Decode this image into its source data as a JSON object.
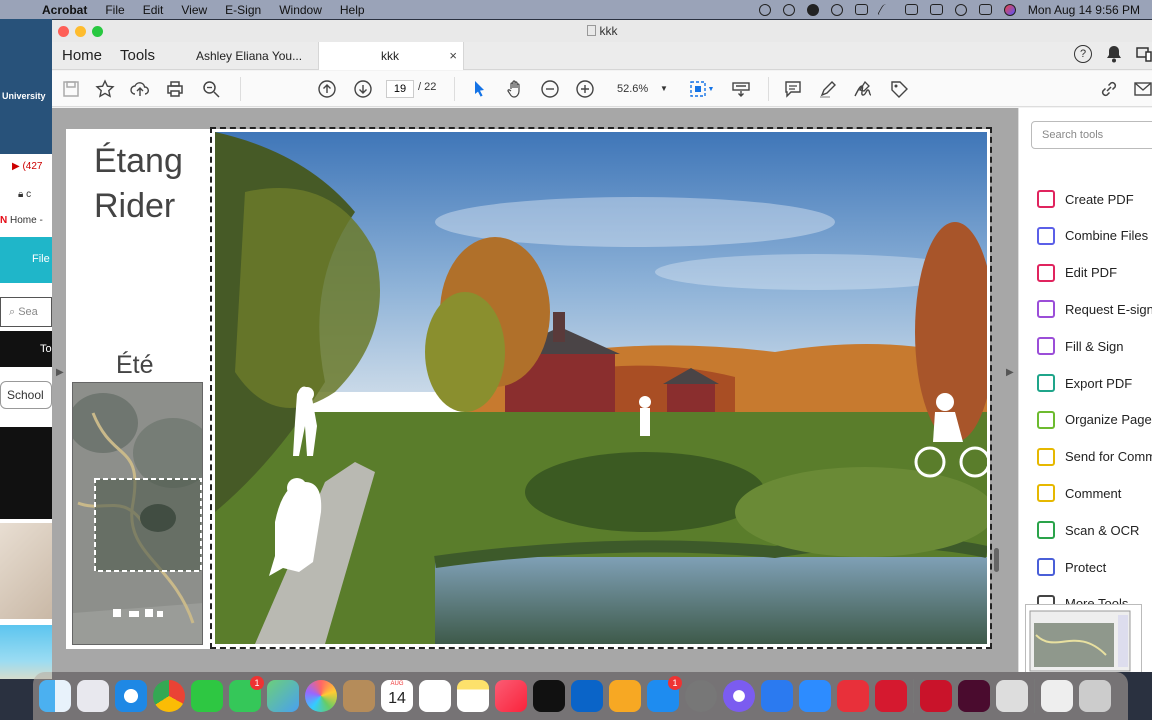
{
  "menubar": {
    "app_name": "Acrobat",
    "items": [
      "File",
      "Edit",
      "View",
      "E-Sign",
      "Window",
      "Help"
    ],
    "datetime": "Mon Aug 14  9:56 PM"
  },
  "background_window": {
    "blue_label": "University",
    "youtube_count": "(427",
    "address_text": "c",
    "netflix_label": "Home -",
    "file_button": "File",
    "search_placeholder": "Sea",
    "dark_tab": "To",
    "school_chip": "School"
  },
  "window": {
    "title": "kkk",
    "tabs": {
      "home": "Home",
      "tools": "Tools",
      "doc1": "Ashley Eliana You...",
      "doc2": "kkk",
      "close": "×"
    },
    "help_icon": "?"
  },
  "toolbar": {
    "current_page": "19",
    "total_pages": "/ 22",
    "zoom": "52.6%"
  },
  "document": {
    "title_line1": "Étang",
    "title_line2": "Rider",
    "season": "Été"
  },
  "tools_panel": {
    "search_placeholder": "Search tools",
    "items": [
      {
        "label": "Create PDF",
        "color": "#e0245e"
      },
      {
        "label": "Combine Files",
        "color": "#5b5fe8"
      },
      {
        "label": "Edit PDF",
        "color": "#e0245e"
      },
      {
        "label": "Request E-signa",
        "color": "#9b4ed8"
      },
      {
        "label": "Fill & Sign",
        "color": "#9b4ed8"
      },
      {
        "label": "Export PDF",
        "color": "#1fa58a"
      },
      {
        "label": "Organize Pages",
        "color": "#6dbb2f"
      },
      {
        "label": "Send for Comme",
        "color": "#e6b800"
      },
      {
        "label": "Comment",
        "color": "#e6b800"
      },
      {
        "label": "Scan & OCR",
        "color": "#2aa34a"
      },
      {
        "label": "Protect",
        "color": "#4a5fd8"
      },
      {
        "label": "More Tools",
        "color": "#444444"
      }
    ]
  },
  "dock": {
    "calendar_month": "AUG",
    "calendar_day": "14",
    "messages_badge": "1",
    "appstore_badge": "1"
  }
}
